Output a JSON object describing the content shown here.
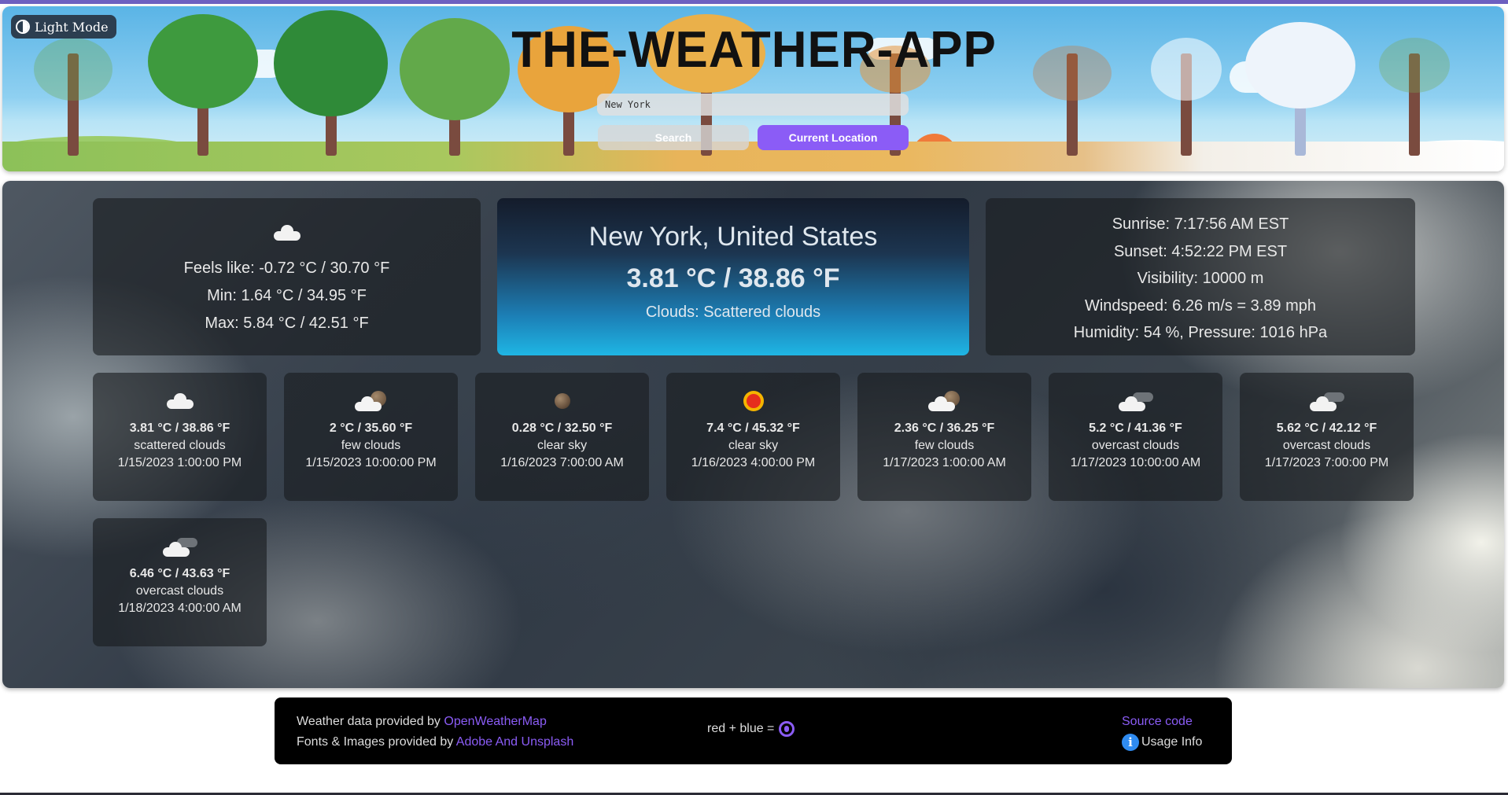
{
  "header": {
    "mode_label": "Light Mode",
    "title": "THE-WEATHER-APP",
    "search_value": "New York",
    "search_label": "Search",
    "location_label": "Current Location"
  },
  "current": {
    "icon": "cloud-icon",
    "feels_like": "Feels like: -0.72 °C / 30.70 °F",
    "min": "Min: 1.64 °C / 34.95 °F",
    "max": "Max: 5.84 °C / 42.51 °F",
    "city": "New York, United States",
    "temp": "3.81 °C / 38.86 °F",
    "clouds": "Clouds: Scattered clouds",
    "sunrise": "Sunrise: 7:17:56 AM EST",
    "sunset": "Sunset: 4:52:22 PM EST",
    "visibility": "Visibility: 10000 m",
    "windspeed": "Windspeed: 6.26 m/s = 3.89 mph",
    "humidity": "Humidity: 54 %, Pressure: 1016 hPa"
  },
  "forecast": [
    {
      "icon": "scattered-clouds-icon",
      "temp": "3.81 °C / 38.86 °F",
      "desc": "scattered clouds",
      "time": "1/15/2023 1:00:00 PM"
    },
    {
      "icon": "few-clouds-icon",
      "temp": "2 °C / 35.60 °F",
      "desc": "few clouds",
      "time": "1/15/2023 10:00:00 PM"
    },
    {
      "icon": "clear-night-icon",
      "temp": "0.28 °C / 32.50 °F",
      "desc": "clear sky",
      "time": "1/16/2023 7:00:00 AM"
    },
    {
      "icon": "sun-icon",
      "temp": "7.4 °C / 45.32 °F",
      "desc": "clear sky",
      "time": "1/16/2023 4:00:00 PM"
    },
    {
      "icon": "few-clouds-icon",
      "temp": "2.36 °C / 36.25 °F",
      "desc": "few clouds",
      "time": "1/17/2023 1:00:00 AM"
    },
    {
      "icon": "overcast-clouds-icon",
      "temp": "5.2 °C / 41.36 °F",
      "desc": "overcast clouds",
      "time": "1/17/2023 10:00:00 AM"
    },
    {
      "icon": "overcast-clouds-icon",
      "temp": "5.62 °C / 42.12 °F",
      "desc": "overcast clouds",
      "time": "1/17/2023 7:00:00 PM"
    },
    {
      "icon": "overcast-clouds-icon",
      "temp": "6.46 °C / 43.63 °F",
      "desc": "overcast clouds",
      "time": "1/18/2023 4:00:00 AM"
    }
  ],
  "footer": {
    "weather_prefix": "Weather data provided by",
    "weather_link": "OpenWeatherMap",
    "fonts_prefix": "Fonts & Images provided by",
    "fonts_link": "Adobe And Unsplash",
    "mid_text": "red + blue =",
    "github_icon": "github-icon",
    "source_link": "Source code",
    "info_icon": "info-icon",
    "info_glyph": "i",
    "usage_label": "Usage Info"
  },
  "colors": {
    "accent": "#8b5cf6",
    "info": "#2f8bf0"
  }
}
